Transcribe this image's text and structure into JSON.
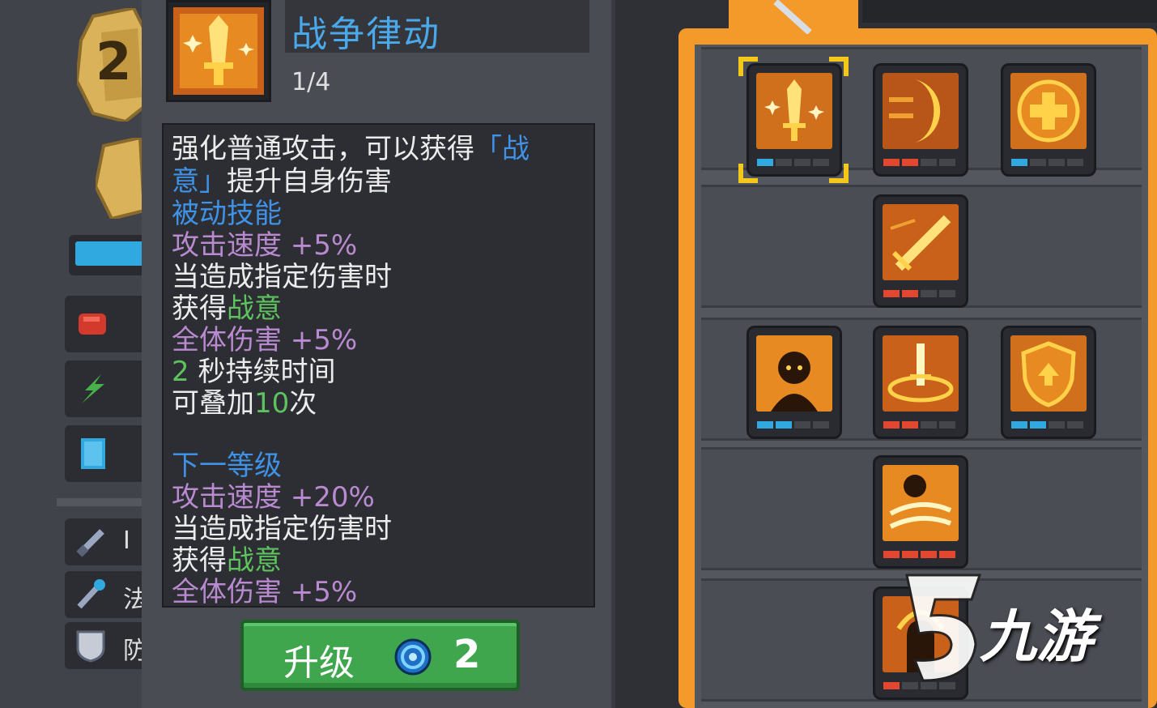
{
  "skill": {
    "title": "战争律动",
    "level": "1/4"
  },
  "description": {
    "line1": "强化普通攻击，可以获得",
    "line1_highlight": "「战",
    "line2_highlight": "意」",
    "line2": "提升自身伤害",
    "passive_label": "被动技能",
    "stat_attack_speed": "攻击速度 +5%",
    "condition": "当造成指定伤害时",
    "gain_prefix": "获得",
    "gain_buff": "战意",
    "stat_all_damage": "全体伤害 +5%",
    "duration_value": "2",
    "duration_suffix": "秒持续时间",
    "stack_prefix": "可叠加",
    "stack_value": "10",
    "stack_suffix": "次",
    "next_level_label": "下一等级",
    "next_attack_speed": "攻击速度 +20%",
    "next_condition": "当造成指定伤害时",
    "next_gain_prefix": "获得",
    "next_gain_buff": "战意",
    "next_all_damage": "全体伤害 +5%"
  },
  "upgrade": {
    "label": "升级",
    "gem_icon": "blue-swirl-gem-icon",
    "cost": "2"
  },
  "side": {
    "badge_number": "2",
    "label_1": "I",
    "label_2": "法",
    "label_3": "防"
  },
  "tree": {
    "rows": [
      {
        "skills": [
          {
            "icon": "sword-sparkle-icon",
            "selected": true,
            "pips": [
              "blue",
              "empty",
              "empty",
              "empty"
            ]
          },
          {
            "icon": "crescent-slash-icon",
            "selected": false,
            "pips": [
              "red",
              "red",
              "empty",
              "empty"
            ]
          },
          {
            "icon": "health-cross-icon",
            "selected": false,
            "pips": [
              "blue",
              "empty",
              "empty",
              "empty"
            ]
          }
        ]
      },
      {
        "skills": [
          {
            "icon": "flying-sword-icon",
            "selected": false,
            "pips": [
              "red",
              "red",
              "empty",
              "empty"
            ]
          }
        ]
      },
      {
        "skills": [
          {
            "icon": "flame-figure-icon",
            "selected": false,
            "pips": [
              "blue",
              "blue",
              "empty",
              "empty"
            ]
          },
          {
            "icon": "sword-ring-icon",
            "selected": false,
            "pips": [
              "red",
              "red",
              "empty",
              "empty"
            ]
          },
          {
            "icon": "shield-arrow-icon",
            "selected": false,
            "pips": [
              "blue",
              "blue",
              "empty",
              "empty"
            ]
          }
        ]
      },
      {
        "skills": [
          {
            "icon": "whirlwind-figure-icon",
            "selected": false,
            "pips": [
              "red",
              "red",
              "red",
              "red"
            ]
          }
        ]
      },
      {
        "skills": [
          {
            "icon": "flame-fist-icon",
            "selected": false,
            "pips": [
              "red",
              "empty",
              "empty",
              "empty"
            ]
          }
        ]
      }
    ]
  },
  "watermark": {
    "text": "九游"
  },
  "colors": {
    "accent_orange": "#f39a2b",
    "title_blue": "#4aa9ea",
    "highlight_blue": "#3f92e6",
    "stat_purple": "#b98ad0",
    "buff_green": "#5ec25e",
    "button_green": "#3fa64d"
  }
}
